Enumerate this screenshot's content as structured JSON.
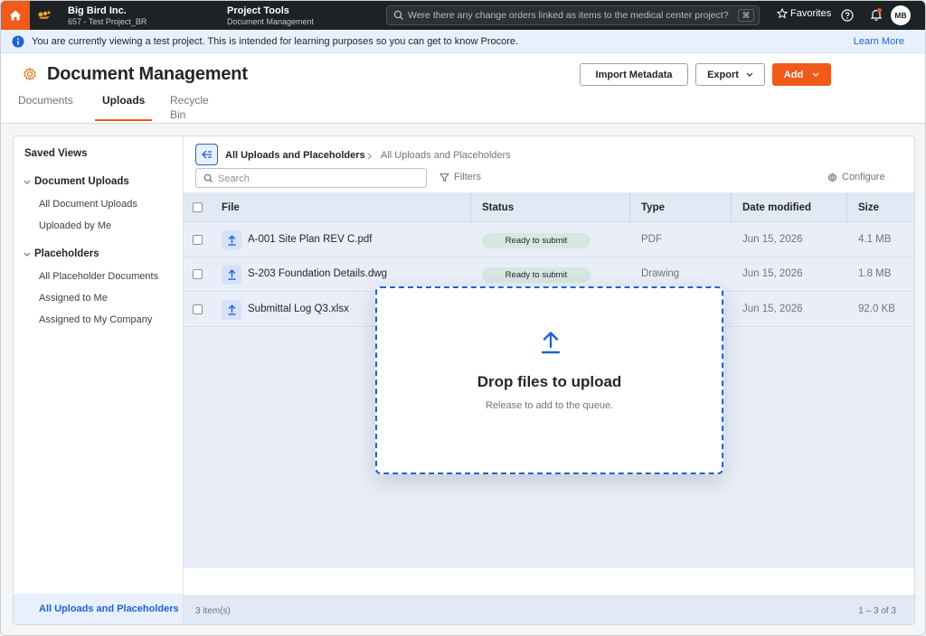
{
  "topbar": {
    "company_name": "Big Bird Inc.",
    "project_name": "657 - Test Project_BR",
    "tool_title": "Project Tools",
    "tool_sub": "Document Management",
    "search_placeholder": "Were there any change orders linked as items to the medical center project?",
    "shortcut": "⌘",
    "favorites_label": "Favorites",
    "avatar_initials": "MB"
  },
  "banner": {
    "message": "You are currently viewing a test project. This is intended for learning purposes so you can get to know Procore.",
    "link_label": "Learn More"
  },
  "header": {
    "title": "Document Management",
    "tabs": [
      "Documents",
      "Uploads",
      "Recycle Bin"
    ],
    "active_tab": "Uploads",
    "import_label": "Import Metadata",
    "export_label": "Export",
    "add_label": "Add"
  },
  "sidebar": {
    "title": "Saved Views",
    "groups": [
      {
        "label": "Document Uploads",
        "items": [
          "All Document Uploads",
          "Uploaded by Me"
        ]
      },
      {
        "label": "Placeholders",
        "items": [
          "All Placeholder Documents",
          "Assigned to Me",
          "Assigned to My Company"
        ]
      }
    ],
    "active_view": "All Uploads and Placeholders"
  },
  "content": {
    "breadcrumb": [
      "All Uploads and Placeholders",
      "All Uploads and Placeholders"
    ],
    "search_placeholder": "Search",
    "filters_label": "Filters",
    "configure_label": "Configure",
    "columns": [
      "File",
      "Status",
      "Type",
      "Date modified",
      "Size"
    ],
    "rows": [
      {
        "file": "A-001 Site Plan REV C.pdf",
        "status": "Ready to submit",
        "type": "PDF",
        "date": "Jun 15, 2026",
        "size": "4.1 MB"
      },
      {
        "file": "S-203 Foundation Details.dwg",
        "status": "Ready to submit",
        "type": "Drawing",
        "date": "Jun 15, 2026",
        "size": "1.8 MB"
      },
      {
        "file": "Submittal Log Q3.xlsx",
        "status": "",
        "type": "",
        "date": "Jun 15, 2026",
        "size": "92.0 KB"
      }
    ],
    "item_count": "3 item(s)",
    "pagination": "1 – 3 of 3"
  },
  "dropzone": {
    "title": "Drop files to upload",
    "subtitle": "Release to add to the queue."
  },
  "colors": {
    "brand_orange": "#f05a1a",
    "accent_blue": "#1f63d1",
    "topbar_bg": "#1f2224"
  }
}
